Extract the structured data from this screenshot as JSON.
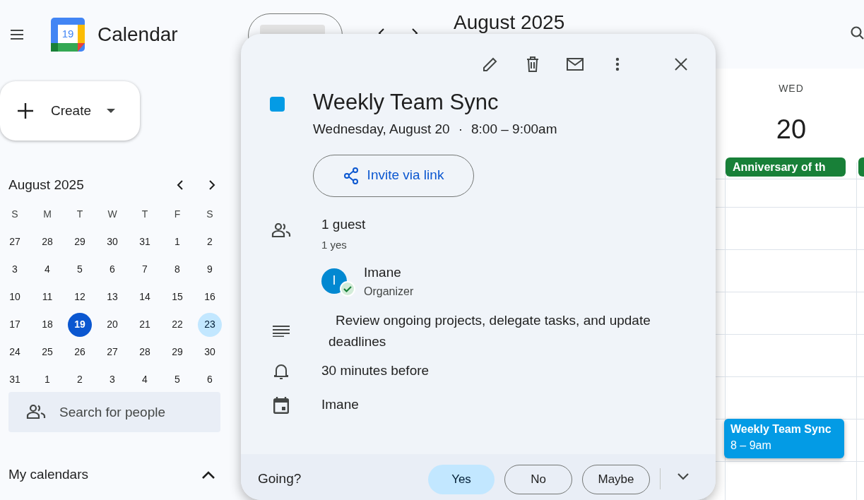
{
  "app": {
    "name": "Calendar",
    "logo_day": "19"
  },
  "header": {
    "title": "August 2025"
  },
  "create_button": {
    "label": "Create"
  },
  "mini_calendar": {
    "title": "August 2025",
    "weekdays": [
      "S",
      "M",
      "T",
      "W",
      "T",
      "F",
      "S"
    ],
    "days": [
      {
        "text": "27",
        "today": false,
        "selected": false
      },
      {
        "text": "28",
        "today": false,
        "selected": false
      },
      {
        "text": "29",
        "today": false,
        "selected": false
      },
      {
        "text": "30",
        "today": false,
        "selected": false
      },
      {
        "text": "31",
        "today": false,
        "selected": false
      },
      {
        "text": "1",
        "today": false,
        "selected": false
      },
      {
        "text": "2",
        "today": false,
        "selected": false
      },
      {
        "text": "3",
        "today": false,
        "selected": false
      },
      {
        "text": "4",
        "today": false,
        "selected": false
      },
      {
        "text": "5",
        "today": false,
        "selected": false
      },
      {
        "text": "6",
        "today": false,
        "selected": false
      },
      {
        "text": "7",
        "today": false,
        "selected": false
      },
      {
        "text": "8",
        "today": false,
        "selected": false
      },
      {
        "text": "9",
        "today": false,
        "selected": false
      },
      {
        "text": "10",
        "today": false,
        "selected": false
      },
      {
        "text": "11",
        "today": false,
        "selected": false
      },
      {
        "text": "12",
        "today": false,
        "selected": false
      },
      {
        "text": "13",
        "today": false,
        "selected": false
      },
      {
        "text": "14",
        "today": false,
        "selected": false
      },
      {
        "text": "15",
        "today": false,
        "selected": false
      },
      {
        "text": "16",
        "today": false,
        "selected": false
      },
      {
        "text": "17",
        "today": false,
        "selected": false
      },
      {
        "text": "18",
        "today": false,
        "selected": false
      },
      {
        "text": "19",
        "today": true,
        "selected": false
      },
      {
        "text": "20",
        "today": false,
        "selected": false
      },
      {
        "text": "21",
        "today": false,
        "selected": false
      },
      {
        "text": "22",
        "today": false,
        "selected": false
      },
      {
        "text": "23",
        "today": false,
        "selected": true
      },
      {
        "text": "24",
        "today": false,
        "selected": false
      },
      {
        "text": "25",
        "today": false,
        "selected": false
      },
      {
        "text": "26",
        "today": false,
        "selected": false
      },
      {
        "text": "27",
        "today": false,
        "selected": false
      },
      {
        "text": "28",
        "today": false,
        "selected": false
      },
      {
        "text": "29",
        "today": false,
        "selected": false
      },
      {
        "text": "30",
        "today": false,
        "selected": false
      },
      {
        "text": "31",
        "today": false,
        "selected": false
      },
      {
        "text": "1",
        "today": false,
        "selected": false
      },
      {
        "text": "2",
        "today": false,
        "selected": false
      },
      {
        "text": "3",
        "today": false,
        "selected": false
      },
      {
        "text": "4",
        "today": false,
        "selected": false
      },
      {
        "text": "5",
        "today": false,
        "selected": false
      },
      {
        "text": "6",
        "today": false,
        "selected": false
      }
    ]
  },
  "people_search": {
    "placeholder": "Search for people"
  },
  "my_calendars": {
    "title": "My calendars",
    "expanded": true
  },
  "day_column": {
    "weekday": "WED",
    "date": "20",
    "all_day_event": {
      "title": "Anniversary of th",
      "color": "#188038"
    },
    "event": {
      "title": "Weekly Team Sync",
      "time": "8 – 9am",
      "color": "#039be5"
    }
  },
  "event_popup": {
    "color": "#039be5",
    "title": "Weekly Team Sync",
    "date": "Wednesday, August 20",
    "separator": "·",
    "time": "8:00 – 9:00am",
    "invite_button": "Invite via link",
    "guests": {
      "count": "1 guest",
      "summary": "1 yes",
      "list": [
        {
          "initial": "I",
          "name": "Imane",
          "role": "Organizer",
          "accepted": true
        }
      ]
    },
    "description": "Review ongoing projects, delegate tasks, and update deadlines",
    "reminder": "30 minutes before",
    "calendar": "Imane",
    "rsvp": {
      "label": "Going?",
      "options": [
        {
          "label": "Yes",
          "selected": true
        },
        {
          "label": "No",
          "selected": false
        },
        {
          "label": "Maybe",
          "selected": false
        }
      ]
    }
  }
}
